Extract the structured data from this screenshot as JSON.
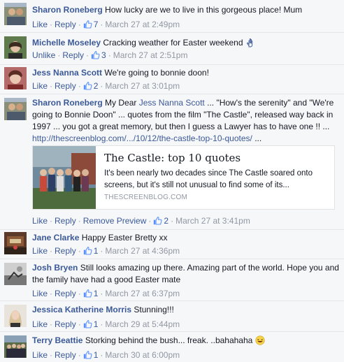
{
  "comments": [
    {
      "author": "Sharon Roneberg",
      "text": "How lucky are we to live in this gorgeous place! Mum",
      "actions": {
        "like": "Like",
        "reply": "Reply",
        "likes": "7",
        "time": "March 27 at 2:49pm"
      }
    },
    {
      "author": "Michelle Moseley",
      "text": "Cracking weather for Easter weekend",
      "emoji_icon": "hand-icon",
      "actions": {
        "like": "Unlike",
        "reply": "Reply",
        "likes": "3",
        "time": "March 27 at 2:51pm"
      }
    },
    {
      "author": "Jess Nanna Scott",
      "text": "We're going to bonnie doon!",
      "actions": {
        "like": "Like",
        "reply": "Reply",
        "likes": "2",
        "time": "March 27 at 3:01pm"
      }
    },
    {
      "author": "Sharon Roneberg",
      "text_before_tag": "My Dear ",
      "tag": "Jess Nanna Scott",
      "text_after_tag": " ... \"How's the serenity\" and \"We're going to Bonnie Doon\" ... quotes from the film \"The Castle\", released way back in 1997 ... you got a great memory, but then I guess a Lawyer has to have one !! ... ",
      "link": "http://thescreenblog.com/.../10/12/the-castle-top-10-quotes/",
      "text_after_link": " ...",
      "preview": {
        "title": "The Castle: top 10 quotes",
        "description": "It's been nearly two decades since The Castle soared onto screens, but it's still not unusual to find some of its...",
        "domain": "THESCREENBLOG.COM"
      },
      "actions": {
        "like": "Like",
        "reply": "Reply",
        "remove_preview": "Remove Preview",
        "likes": "2",
        "time": "March 27 at 3:41pm"
      }
    },
    {
      "author": "Jane Clarke",
      "text": "Happy Easter Bretty xx",
      "actions": {
        "like": "Like",
        "reply": "Reply",
        "likes": "1",
        "time": "March 27 at 4:36pm"
      }
    },
    {
      "author": "Josh Bryen",
      "text": "Still looks amazing up there. Amazing part of the world. Hope you and the family have had a good Easter mate",
      "actions": {
        "like": "Like",
        "reply": "Reply",
        "likes": "1",
        "time": "March 27 at 6:37pm"
      }
    },
    {
      "author": "Jessica Katherine Morris",
      "text": "Stunning!!!",
      "actions": {
        "like": "Like",
        "reply": "Reply",
        "likes": "1",
        "time": "March 29 at 5:44pm"
      }
    },
    {
      "author": "Terry Beattie",
      "text": "Storking behind the bush... freak. ..bahahaha",
      "emoji_icon": "laughing-face-icon",
      "actions": {
        "like": "Like",
        "reply": "Reply",
        "likes": "1",
        "time": "March 30 at 6:00pm"
      }
    }
  ],
  "colors": {
    "background": "#f6f7f9",
    "name_link": "#3b5998",
    "meta_text": "#9197a3",
    "text": "#141823"
  }
}
